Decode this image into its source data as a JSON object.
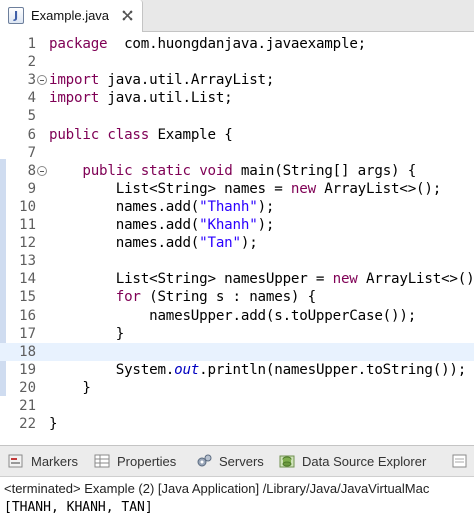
{
  "editor_tab": {
    "title": "Example.java",
    "icon": "java-file-icon",
    "close_icon": "close-icon"
  },
  "colors": {
    "keyword": "#7f0055",
    "string": "#2a00ff",
    "static_field": "#0000c0",
    "current_line": "#e8f2fe",
    "ruler_mark": "#cfdcf0"
  },
  "code_lines": [
    {
      "n": "1",
      "fold": false,
      "current": false,
      "tokens": [
        [
          "kw",
          "package"
        ],
        [
          "",
          "  com.huongdanjava.javaexample;"
        ]
      ]
    },
    {
      "n": "2",
      "fold": false,
      "current": false,
      "tokens": []
    },
    {
      "n": "3",
      "fold": true,
      "current": false,
      "tokens": [
        [
          "kw",
          "import"
        ],
        [
          "",
          " java.util.ArrayList;"
        ]
      ]
    },
    {
      "n": "4",
      "fold": false,
      "current": false,
      "tokens": [
        [
          "kw",
          "import"
        ],
        [
          "",
          " java.util.List;"
        ]
      ]
    },
    {
      "n": "5",
      "fold": false,
      "current": false,
      "tokens": []
    },
    {
      "n": "6",
      "fold": false,
      "current": false,
      "tokens": [
        [
          "kw",
          "public"
        ],
        [
          "",
          " "
        ],
        [
          "kw",
          "class"
        ],
        [
          "",
          " Example {"
        ]
      ]
    },
    {
      "n": "7",
      "fold": false,
      "current": false,
      "tokens": []
    },
    {
      "n": "8",
      "fold": true,
      "current": false,
      "tokens": [
        [
          "",
          "    "
        ],
        [
          "kw",
          "public"
        ],
        [
          "",
          " "
        ],
        [
          "kw",
          "static"
        ],
        [
          "",
          " "
        ],
        [
          "kw",
          "void"
        ],
        [
          "",
          " main(String[] args) {"
        ]
      ]
    },
    {
      "n": "9",
      "fold": false,
      "current": false,
      "tokens": [
        [
          "",
          "        List<String> names = "
        ],
        [
          "kw",
          "new"
        ],
        [
          "",
          " ArrayList<>();"
        ]
      ]
    },
    {
      "n": "10",
      "fold": false,
      "current": false,
      "tokens": [
        [
          "",
          "        names.add("
        ],
        [
          "str",
          "\"Thanh\""
        ],
        [
          "",
          ");"
        ]
      ]
    },
    {
      "n": "11",
      "fold": false,
      "current": false,
      "tokens": [
        [
          "",
          "        names.add("
        ],
        [
          "str",
          "\"Khanh\""
        ],
        [
          "",
          ");"
        ]
      ]
    },
    {
      "n": "12",
      "fold": false,
      "current": false,
      "tokens": [
        [
          "",
          "        names.add("
        ],
        [
          "str",
          "\"Tan\""
        ],
        [
          "",
          ");"
        ]
      ]
    },
    {
      "n": "13",
      "fold": false,
      "current": false,
      "tokens": []
    },
    {
      "n": "14",
      "fold": false,
      "current": false,
      "tokens": [
        [
          "",
          "        List<String> namesUpper = "
        ],
        [
          "kw",
          "new"
        ],
        [
          "",
          " ArrayList<>();"
        ]
      ]
    },
    {
      "n": "15",
      "fold": false,
      "current": false,
      "tokens": [
        [
          "",
          "        "
        ],
        [
          "kw",
          "for"
        ],
        [
          "",
          " (String s : names) {"
        ]
      ]
    },
    {
      "n": "16",
      "fold": false,
      "current": false,
      "tokens": [
        [
          "",
          "            namesUpper.add(s.toUpperCase());"
        ]
      ]
    },
    {
      "n": "17",
      "fold": false,
      "current": false,
      "tokens": [
        [
          "",
          "        }"
        ]
      ]
    },
    {
      "n": "18",
      "fold": false,
      "current": true,
      "tokens": []
    },
    {
      "n": "19",
      "fold": false,
      "current": false,
      "tokens": [
        [
          "",
          "        System."
        ],
        [
          "sf",
          "out"
        ],
        [
          "",
          ".println(namesUpper.toString());"
        ]
      ]
    },
    {
      "n": "20",
      "fold": false,
      "current": false,
      "tokens": [
        [
          "",
          "    }"
        ]
      ]
    },
    {
      "n": "21",
      "fold": false,
      "current": false,
      "tokens": []
    },
    {
      "n": "22",
      "fold": false,
      "current": false,
      "tokens": [
        [
          "",
          "}"
        ]
      ]
    }
  ],
  "views": {
    "tabs": [
      {
        "label": "Markers",
        "icon": "markers-icon"
      },
      {
        "label": "Properties",
        "icon": "properties-icon"
      },
      {
        "label": "Servers",
        "icon": "servers-icon"
      },
      {
        "label": "Data Source Explorer",
        "icon": "data-source-explorer-icon"
      },
      {
        "label": "",
        "icon": "snippets-icon"
      }
    ]
  },
  "console": {
    "header": "<terminated> Example (2) [Java Application] /Library/Java/JavaVirtualMac",
    "output": "[THANH, KHANH, TAN]"
  }
}
